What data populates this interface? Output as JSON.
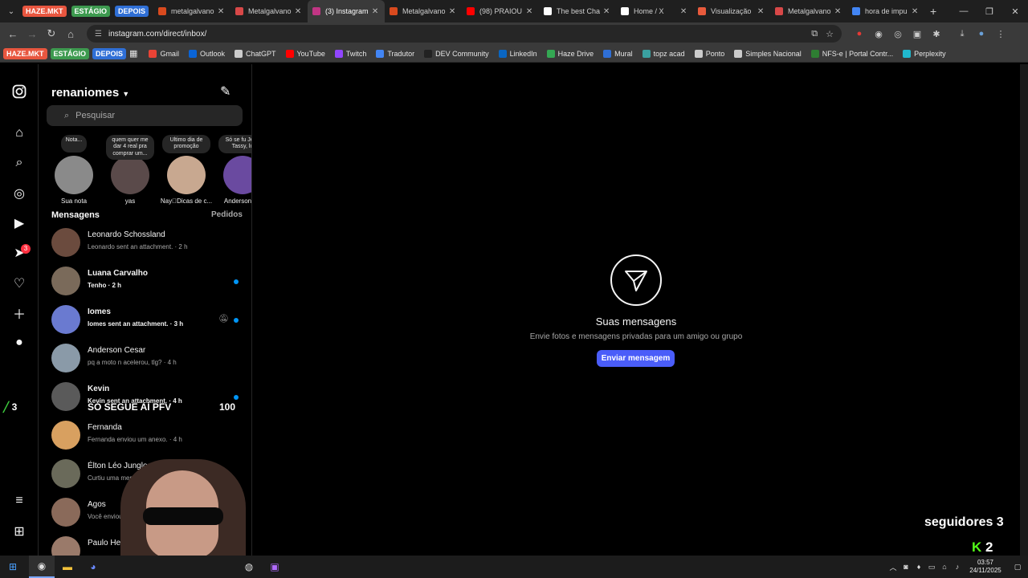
{
  "browser": {
    "tab_groups": [
      {
        "label": "HAZE.MKT",
        "color": "#e8563f"
      },
      {
        "label": "ESTÁGIO",
        "color": "#3d9a4f"
      },
      {
        "label": "DEPOIS",
        "color": "#2f6fd6"
      }
    ],
    "tabs": [
      {
        "title": "metalgalvano",
        "favicon": "#d94a1e",
        "active": false
      },
      {
        "title": "Metalgalvano",
        "favicon": "#d84848",
        "active": false
      },
      {
        "title": "(3) Instagram",
        "favicon": "#c13584",
        "active": true
      },
      {
        "title": "Metalgalvano",
        "favicon": "#d94a1e",
        "active": false
      },
      {
        "title": "(98) PRAIOU",
        "favicon": "#ff0000",
        "active": false
      },
      {
        "title": "The best Cha",
        "favicon": "#ffffff",
        "active": false
      },
      {
        "title": "Home / X",
        "favicon": "#ffffff",
        "active": false
      },
      {
        "title": "Visualização",
        "favicon": "#e85a3c",
        "active": false
      },
      {
        "title": "Metalgalvano",
        "favicon": "#d84848",
        "active": false
      },
      {
        "title": "hora de impu",
        "favicon": "#4285f4",
        "active": false
      }
    ],
    "url": "instagram.com/direct/inbox/",
    "bookmark_groups": [
      {
        "label": "HAZE.MKT",
        "color": "#e8563f"
      },
      {
        "label": "ESTÁGIO",
        "color": "#3d9a4f"
      },
      {
        "label": "DEPOIS",
        "color": "#2f6fd6"
      }
    ],
    "bookmarks": [
      {
        "label": "Gmail",
        "color": "#ea4335"
      },
      {
        "label": "Outlook",
        "color": "#0a64d6"
      },
      {
        "label": "ChatGPT",
        "color": "#cccccc"
      },
      {
        "label": "YouTube",
        "color": "#ff0000"
      },
      {
        "label": "Twitch",
        "color": "#9146ff"
      },
      {
        "label": "Tradutor",
        "color": "#4285f4"
      },
      {
        "label": "DEV Community",
        "color": "#222222"
      },
      {
        "label": "LinkedIn",
        "color": "#0a66c2"
      },
      {
        "label": "Haze Drive",
        "color": "#34a853"
      },
      {
        "label": "Mural",
        "color": "#2f6fd6"
      },
      {
        "label": "topz acad",
        "color": "#3aa0a0"
      },
      {
        "label": "Ponto",
        "color": "#cccccc"
      },
      {
        "label": "Simples Nacional",
        "color": "#cccccc"
      },
      {
        "label": "NFS-e | Portal Contr...",
        "color": "#2e7d32"
      },
      {
        "label": "Perplexity",
        "color": "#20b8cd"
      }
    ]
  },
  "instagram": {
    "username": "renaniomes",
    "search_placeholder": "Pesquisar",
    "notes": [
      {
        "note": "Nota...",
        "name": "Sua nota",
        "avatar": "#8a8a8a"
      },
      {
        "note": "quem quer me dar 4 real pra comprar um...",
        "name": "yas",
        "avatar": "#5a4a4a"
      },
      {
        "note": "Ultimo dia de promoção",
        "name": "Nay\u0000Dicas de c...",
        "avatar": "#c8a890"
      },
      {
        "note": "Só se fu Jean Tassy, lu",
        "name": "Anderson So",
        "avatar": "#6a4aa0"
      }
    ],
    "messages_heading": "Mensagens",
    "requests_label": "Pedidos",
    "threads": [
      {
        "name": "Leonardo Schossland",
        "preview": "Leonardo sent an attachment. · 2 h",
        "unread": false,
        "muted": false,
        "avatar": "#6b4b3e"
      },
      {
        "name": "Luana Carvalho",
        "preview": "Tenho · 2 h",
        "unread": true,
        "muted": false,
        "avatar": "#7a6a5a"
      },
      {
        "name": "Iomes",
        "preview": "Iomes sent an attachment. · 3 h",
        "unread": true,
        "muted": true,
        "avatar": "#6a7ad0"
      },
      {
        "name": "Anderson Cesar",
        "preview": "pq a moto n acelerou, tlg? · 4 h",
        "unread": false,
        "muted": false,
        "avatar": "#8a9aa8"
      },
      {
        "name": "Kevin",
        "preview": "Kevin sent an attachment. · 4 h",
        "unread": true,
        "muted": false,
        "avatar": "#5a5a5a"
      },
      {
        "name": "Fernanda",
        "preview": "Fernanda enviou um anexo. · 4 h",
        "unread": false,
        "muted": false,
        "avatar": "#d8a060"
      },
      {
        "name": "Élton Léo Junglos",
        "preview": "Curtiu uma mensa",
        "unread": false,
        "muted": false,
        "avatar": "#6a6a5a"
      },
      {
        "name": "Agos",
        "preview": "Você enviou",
        "unread": false,
        "muted": false,
        "avatar": "#8a6a5a"
      },
      {
        "name": "Paulo Her",
        "preview": "",
        "unread": false,
        "muted": false,
        "avatar": "#9a7a6a"
      }
    ],
    "empty_state": {
      "title": "Suas mensagens",
      "subtitle": "Envie fotos e mensagens privadas para um amigo ou grupo",
      "button": "Enviar mensagem"
    },
    "notification_count": "3"
  },
  "overlay": {
    "left_count": "3",
    "banner": "SÓ SEGUE AÍ PFV",
    "banner_count": "100",
    "followers": "seguidores 3",
    "kick_count": "2"
  },
  "taskbar": {
    "time": "03:57",
    "date": "24/11/2025"
  }
}
